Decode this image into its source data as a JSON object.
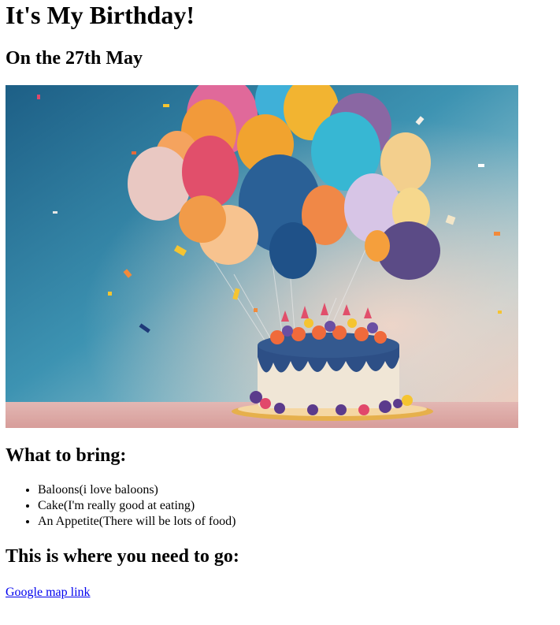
{
  "page": {
    "title": "It's My Birthday!",
    "subtitle": "On the 27th May"
  },
  "hero_image": {
    "alt": "",
    "icon": "birthday-cake-with-balloons"
  },
  "bring_section": {
    "heading": "What to bring:",
    "items": [
      "Baloons(i love baloons)",
      "Cake(I'm really good at eating)",
      "An Appetite(There will be lots of food)"
    ]
  },
  "location_section": {
    "heading": "This is where you need to go:",
    "link_text": "Google map link"
  },
  "colors": {
    "link": "#0000ee",
    "text": "#000000",
    "background": "#ffffff"
  }
}
